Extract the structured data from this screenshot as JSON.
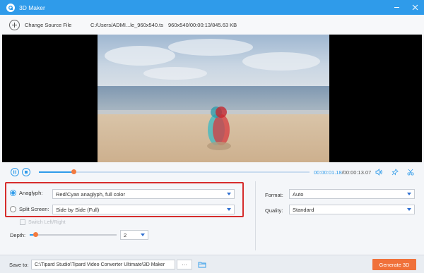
{
  "window": {
    "title": "3D Maker"
  },
  "source": {
    "change_label": "Change Source File",
    "file_path": "C:/Users/ADMI...le_960x540.ts",
    "file_info": "960x540/00:00:13/845.63 KB"
  },
  "playback": {
    "current_time": "00:00:01.18",
    "duration": "/00:00:13.07",
    "progress": 0.13
  },
  "settings": {
    "anaglyph": {
      "label": "Anaglyph:",
      "value": "Red/Cyan anaglyph, full color",
      "selected": true
    },
    "split_screen": {
      "label": "Split Screen:",
      "value": "Side by Side (Full)",
      "selected": false
    },
    "switch_lr": {
      "label": "Switch Left/Right",
      "enabled": false
    },
    "depth": {
      "label": "Depth:",
      "value": "2",
      "slider_fraction": 0.07
    },
    "format": {
      "label": "Format:",
      "value": "Auto"
    },
    "quality": {
      "label": "Quality:",
      "value": "Standard"
    }
  },
  "output": {
    "save_label": "Save to:",
    "save_path": "C:\\Tipard Studio\\Tipard Video Converter Ultimate\\3D Maker",
    "browse_label": "···",
    "generate_label": "Generate 3D"
  },
  "colors": {
    "accent": "#2f9bea",
    "generate": "#f0713a",
    "highlight": "#d62c2c"
  }
}
